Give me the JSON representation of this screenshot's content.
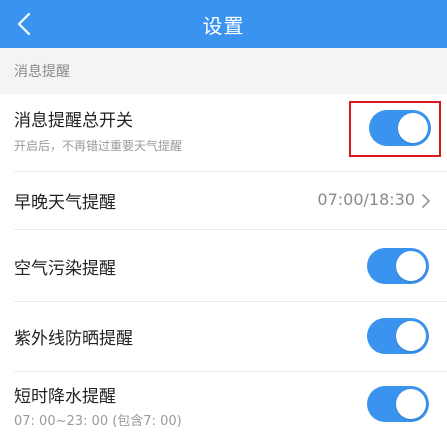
{
  "header": {
    "title": "设置",
    "back_icon": "chevron-left-icon",
    "background": "#3b93f0"
  },
  "section": {
    "title": "消息提醒"
  },
  "rows": {
    "master_switch": {
      "title": "消息提醒总开关",
      "subtitle": "开启后，不再错过重要天气提醒",
      "enabled": true
    },
    "morning_evening": {
      "title": "早晚天气提醒",
      "value": "07:00/18:30",
      "icon": "chevron-right-icon"
    },
    "air_pollution": {
      "title": "空气污染提醒",
      "enabled": true
    },
    "uv": {
      "title": "紫外线防晒提醒",
      "enabled": true
    },
    "precipitation": {
      "title": "短时降水提醒",
      "subtitle": "07: 00~23: 00 (包含7: 00)",
      "enabled": true
    }
  },
  "colors": {
    "accent": "#3b93f0",
    "highlight": "#d9171d",
    "section_bg": "#f4f4f4"
  }
}
